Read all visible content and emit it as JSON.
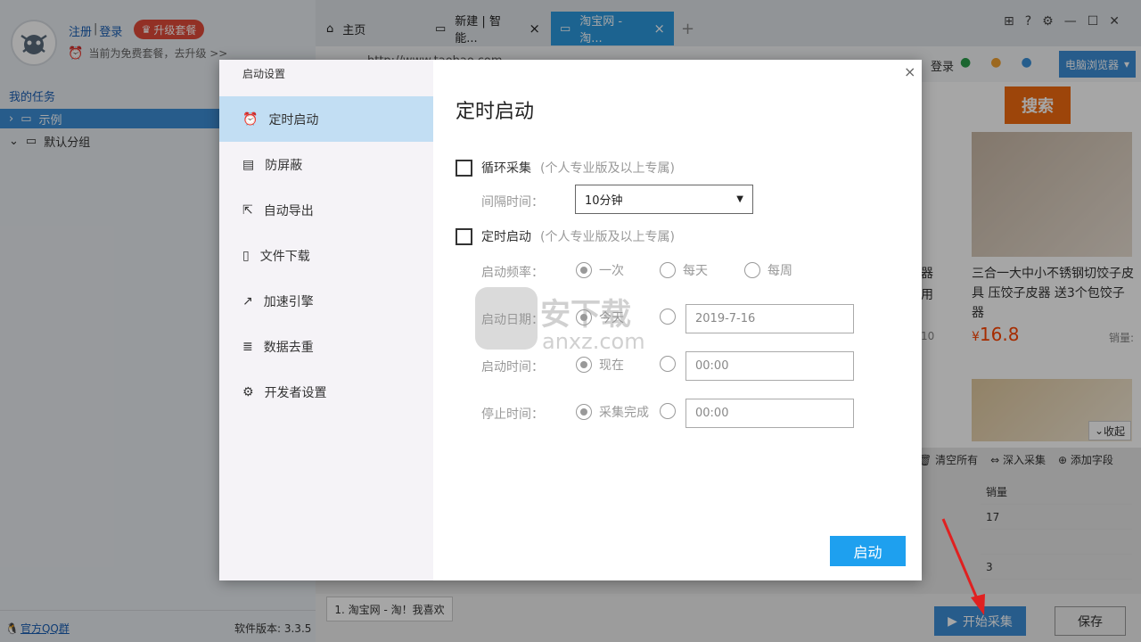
{
  "sidebar": {
    "register": "注册",
    "separator": "|",
    "login": "登录",
    "upgrade": "升级套餐",
    "plan_note": "当前为免费套餐，去升级 >>",
    "tasks_header": "我的任务",
    "tree": [
      {
        "label": "示例"
      },
      {
        "label": "默认分组"
      }
    ],
    "qq_group": "官方QQ群",
    "version": "软件版本: 3.3.5"
  },
  "tabs": [
    {
      "label": "主页"
    },
    {
      "label": "新建 | 智能..."
    },
    {
      "label": "淘宝网 - 淘..."
    }
  ],
  "browser": {
    "url": "http://www.taobao.com",
    "login_text": "登录",
    "browser_button": "电脑浏览器",
    "search_button": "搜索",
    "partial_text_1": "器",
    "partial_text_2": "用",
    "partial_text_3": "10",
    "product": {
      "title": "三合一大中小不锈钢切饺子皮具 压饺子皮器 送3个包饺子器",
      "currency": "¥",
      "price": "16.8",
      "sales_label": "销量:"
    },
    "collapse": "收起"
  },
  "data_panel": {
    "toolbar": [
      "清空所有",
      "深入采集",
      "添加字段"
    ],
    "column_header": "销量",
    "rows": [
      "17",
      "",
      "3"
    ]
  },
  "bottom": {
    "page_tab": "1. 淘宝网 - 淘！我喜欢",
    "start_collect": "开始采集",
    "save": "保存"
  },
  "dialog": {
    "title": "启动设置",
    "nav": [
      {
        "label": "定时启动",
        "icon": "alarm-clock-icon",
        "active": true
      },
      {
        "label": "防屏蔽",
        "icon": "shield-screen-icon"
      },
      {
        "label": "自动导出",
        "icon": "export-icon"
      },
      {
        "label": "文件下载",
        "icon": "file-download-icon"
      },
      {
        "label": "加速引擎",
        "icon": "chart-boost-icon"
      },
      {
        "label": "数据去重",
        "icon": "dedup-list-icon"
      },
      {
        "label": "开发者设置",
        "icon": "gear-icon"
      }
    ],
    "heading": "定时启动",
    "loop": {
      "label": "循环采集",
      "note": "(个人专业版及以上专属)"
    },
    "interval": {
      "label": "间隔时间：",
      "value": "10分钟"
    },
    "scheduled": {
      "label": "定时启动",
      "note": "(个人专业版及以上专属)"
    },
    "frequency": {
      "label": "启动频率：",
      "options": [
        "一次",
        "每天",
        "每周"
      ],
      "selected": "一次"
    },
    "start_date": {
      "label": "启动日期：",
      "option": "今天",
      "value": "2019-7-16"
    },
    "start_time": {
      "label": "启动时间：",
      "option": "现在",
      "value": "00:00"
    },
    "stop_time": {
      "label": "停止时间：",
      "option": "采集完成",
      "value": "00:00"
    },
    "start_button": "启动",
    "close": "×"
  },
  "watermark": {
    "line1": "安下载",
    "line2": "anxz.com"
  },
  "colors": {
    "accent": "#1ea0ef",
    "active_nav": "#c2def3",
    "price": "#ff4400",
    "search": "#f26a10"
  }
}
